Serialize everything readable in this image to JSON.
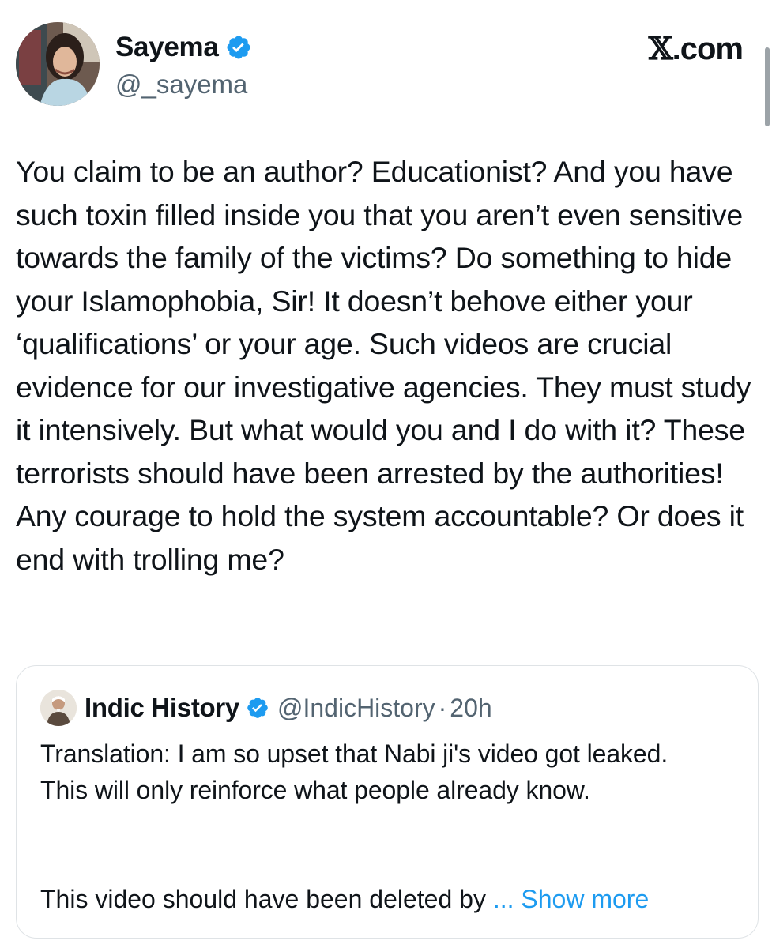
{
  "author": {
    "name": "Sayema",
    "handle": "@_sayema",
    "verified_color": "#1d9bf0",
    "avatar_icon": "profile-photo"
  },
  "brand": {
    "x_glyph": "𝕏",
    "suffix": ".com"
  },
  "tweet": {
    "text": "You claim to be an author? Educationist? And you have such toxin filled inside you that you aren’t even sensitive towards the family of the victims? Do something to hide your Islamophobia, Sir! It doesn’t behove either your ‘qualifications’ or your age. Such videos are crucial evidence for our investigative agencies. They must study it intensively. But what would you and I do with it? These terrorists should have been arrested by the authorities! Any courage to hold the system accountable? Or does it end with trolling me?"
  },
  "quoted_tweet": {
    "name": "Indic History",
    "handle": "@IndicHistory",
    "separator": "·",
    "time": "20h",
    "text": "Translation: I am so upset that Nabi ji's video got leaked. This will only reinforce what people already know.",
    "truncated_text": "This video should have been deleted by",
    "ellipsis": "...",
    "show_more": "Show more",
    "link_color": "#1d9bf0"
  }
}
